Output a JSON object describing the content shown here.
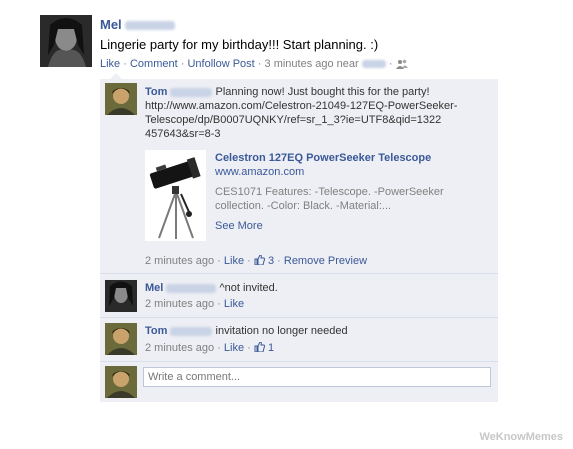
{
  "post": {
    "author": "Mel",
    "text": "Lingerie party for my birthday!!! Start planning. :)",
    "actions": {
      "like": "Like",
      "comment": "Comment",
      "unfollow": "Unfollow Post",
      "time": "3 minutes ago near"
    }
  },
  "comments": [
    {
      "author": "Tom",
      "text": "Planning now! Just bought this for the party!",
      "url": "http://www.amazon.com/Celestron-21049-127EQ-PowerSeeker-Telescope/dp/B0007UQNKY/ref=sr_1_3?ie=UTF8&qid=1322457643&sr=8-3",
      "url_lines": [
        "http://www.amazon.com/Celestron-21049-127EQ-PowerSeeker-",
        "Telescope/dp/B0007UQNKY/ref=sr_1_3?ie=UTF8&qid=1322",
        "457643&sr=8-3"
      ],
      "preview": {
        "title": "Celestron 127EQ PowerSeeker Telescope",
        "domain": "www.amazon.com",
        "desc_line1": "CES1071 Features: -Telescope. -PowerSeeker",
        "desc_line2": "collection. -Color: Black. -Material:...",
        "see_more": "See More"
      },
      "time": "2 minutes ago",
      "like": "Like",
      "likes_count": "3",
      "remove_preview": "Remove Preview"
    },
    {
      "author": "Mel",
      "text": "^not invited.",
      "time": "2 minutes ago",
      "like": "Like"
    },
    {
      "author": "Tom",
      "text": "invitation no longer needed",
      "time": "2 minutes ago",
      "like": "Like",
      "likes_count": "1"
    }
  ],
  "composer": {
    "placeholder": "Write a comment..."
  },
  "watermark": "WeKnowMemes",
  "colors": {
    "link": "#3b5998",
    "comment_bg": "#edeff4",
    "divider": "#d8dfea"
  }
}
